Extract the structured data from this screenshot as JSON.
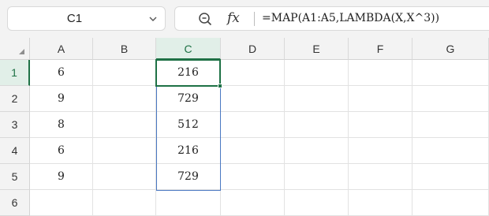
{
  "name_box": {
    "value": "C1"
  },
  "formula_bar": {
    "fx_label": "fx",
    "formula": "=MAP(A1:A5,LAMBDA(X,X^3))"
  },
  "icons": [
    "chevron-down-icon",
    "zoom-icon",
    "fx-icon",
    "select-all-icon"
  ],
  "columns": [
    "A",
    "B",
    "C",
    "D",
    "E",
    "F",
    "G"
  ],
  "rows": [
    "1",
    "2",
    "3",
    "4",
    "5",
    "6"
  ],
  "selected_cell": {
    "column": "C",
    "row": "1"
  },
  "cells": {
    "A": [
      "6",
      "9",
      "8",
      "6",
      "9",
      ""
    ],
    "B": [
      "",
      "",
      "",
      "",
      "",
      ""
    ],
    "C": [
      "216",
      "729",
      "512",
      "216",
      "729",
      ""
    ],
    "D": [
      "",
      "",
      "",
      "",
      "",
      ""
    ],
    "E": [
      "",
      "",
      "",
      "",
      "",
      ""
    ],
    "F": [
      "",
      "",
      "",
      "",
      "",
      ""
    ],
    "G": [
      "",
      "",
      "",
      "",
      "",
      ""
    ]
  },
  "colors": {
    "selection_green": "#1e7145",
    "header_highlight": "#e1efe8",
    "spill_border": "#4a78c2",
    "toolbar_bg": "#f3f3f3"
  }
}
